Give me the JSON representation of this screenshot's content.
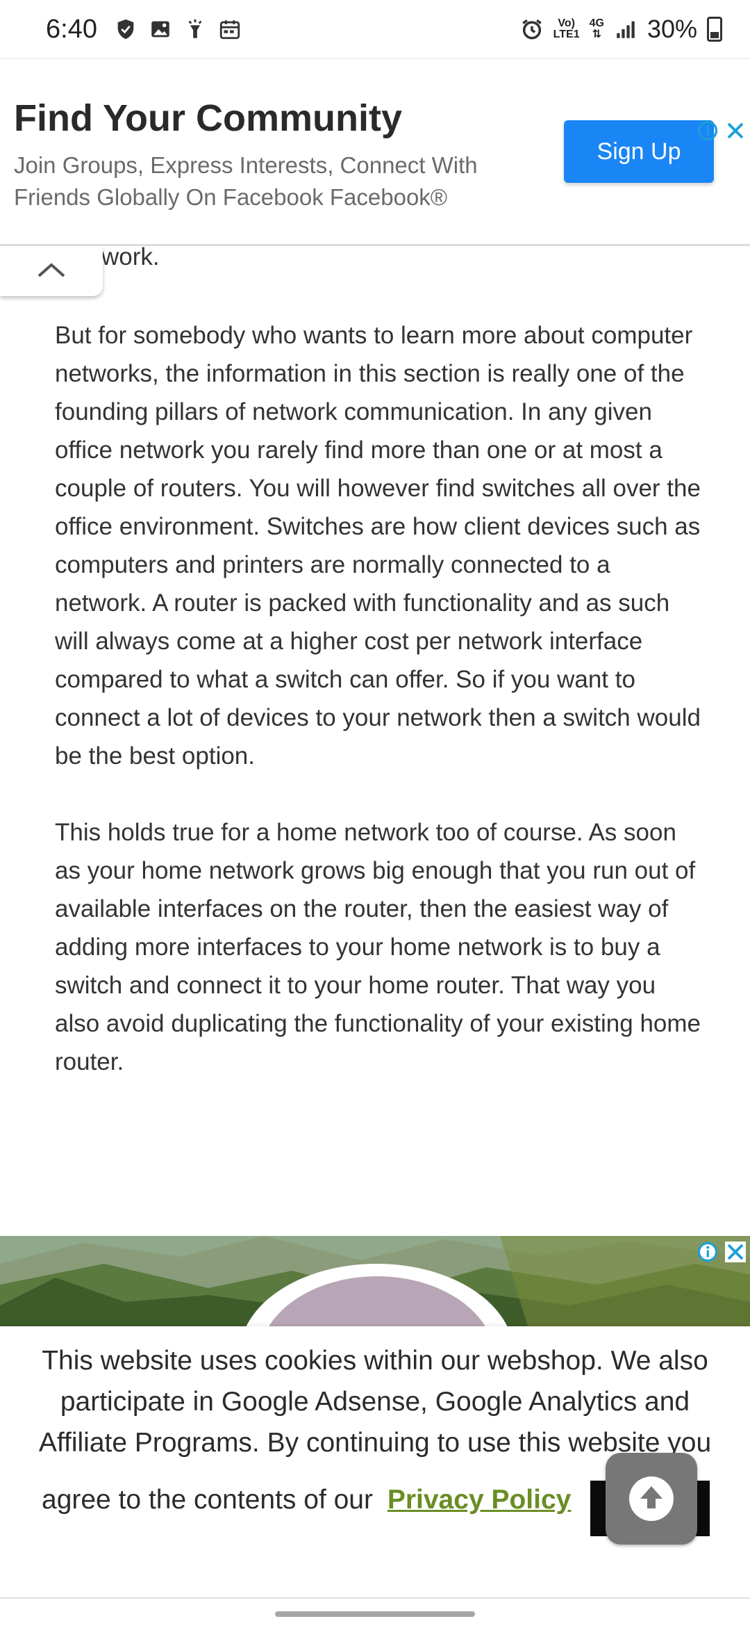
{
  "status_bar": {
    "time": "6:40",
    "network_label_top": "Vo)",
    "network_label_bottom": "LTE1",
    "network_type": "4G",
    "battery": "30%"
  },
  "top_ad": {
    "title": "Find Your Community",
    "description": "Join Groups, Express Interests, Connect With Friends Globally On Facebook Facebook®",
    "cta_label": "Sign Up"
  },
  "article": {
    "partial_text": "work.",
    "paragraphs": [
      "But for somebody who wants to learn more about computer networks, the information in this section is really one of the founding pillars of network communication. In any given office network you rarely find more than one or at most a couple of routers. You will however find switches all over the office environment. Switches are how client devices such as computers and printers are normally connected to a network. A router is packed with functionality and as such will always come at a higher cost per network interface compared to what a switch can offer. So if you want to connect a lot of devices to your network then a switch would be the best option.",
      "This holds true for a home network too of course. As soon as your home network grows big enough that you run out of available interfaces on the router, then the easiest way of adding more interfaces to your home network is to buy a switch and connect it to your home router. That way you also avoid duplicating the functionality of your existing home router."
    ]
  },
  "cookie_banner": {
    "text": "This website uses cookies within our webshop. We also participate in Google Adsense, Google Analytics and Affiliate Programs. By continuing to use this website you",
    "last_line": "agree to the contents of our",
    "privacy_link": "Privacy Policy"
  },
  "colors": {
    "accent_blue": "#1a85f5",
    "link_green": "#6a8d24",
    "adchoices_blue": "#1ba0d8"
  }
}
